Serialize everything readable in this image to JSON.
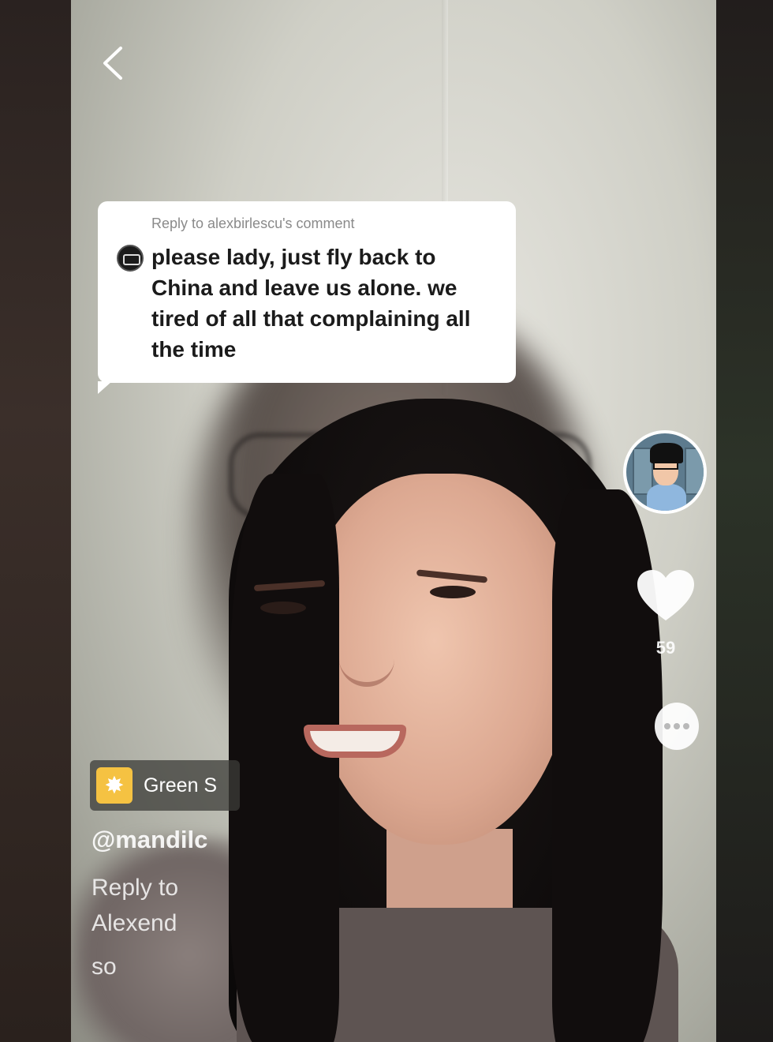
{
  "reply_card": {
    "header": "Reply to alexbirlescu's comment",
    "comment": "please lady, just fly back to China and leave us alone. we tired of all that complaining all the time"
  },
  "actions": {
    "like_count": "59",
    "back_icon": "chevron-left-icon",
    "like_icon": "heart-icon",
    "comment_icon": "comment-bubble-icon"
  },
  "effect": {
    "label": "Green S",
    "icon": "sparkle-icon"
  },
  "post": {
    "username": "@mandilc",
    "caption_line1": "Reply to",
    "caption_line2": "Alexend",
    "caption_line3": "so"
  },
  "colors": {
    "effect_icon": "#f5c242",
    "card_bg": "#ffffff"
  }
}
